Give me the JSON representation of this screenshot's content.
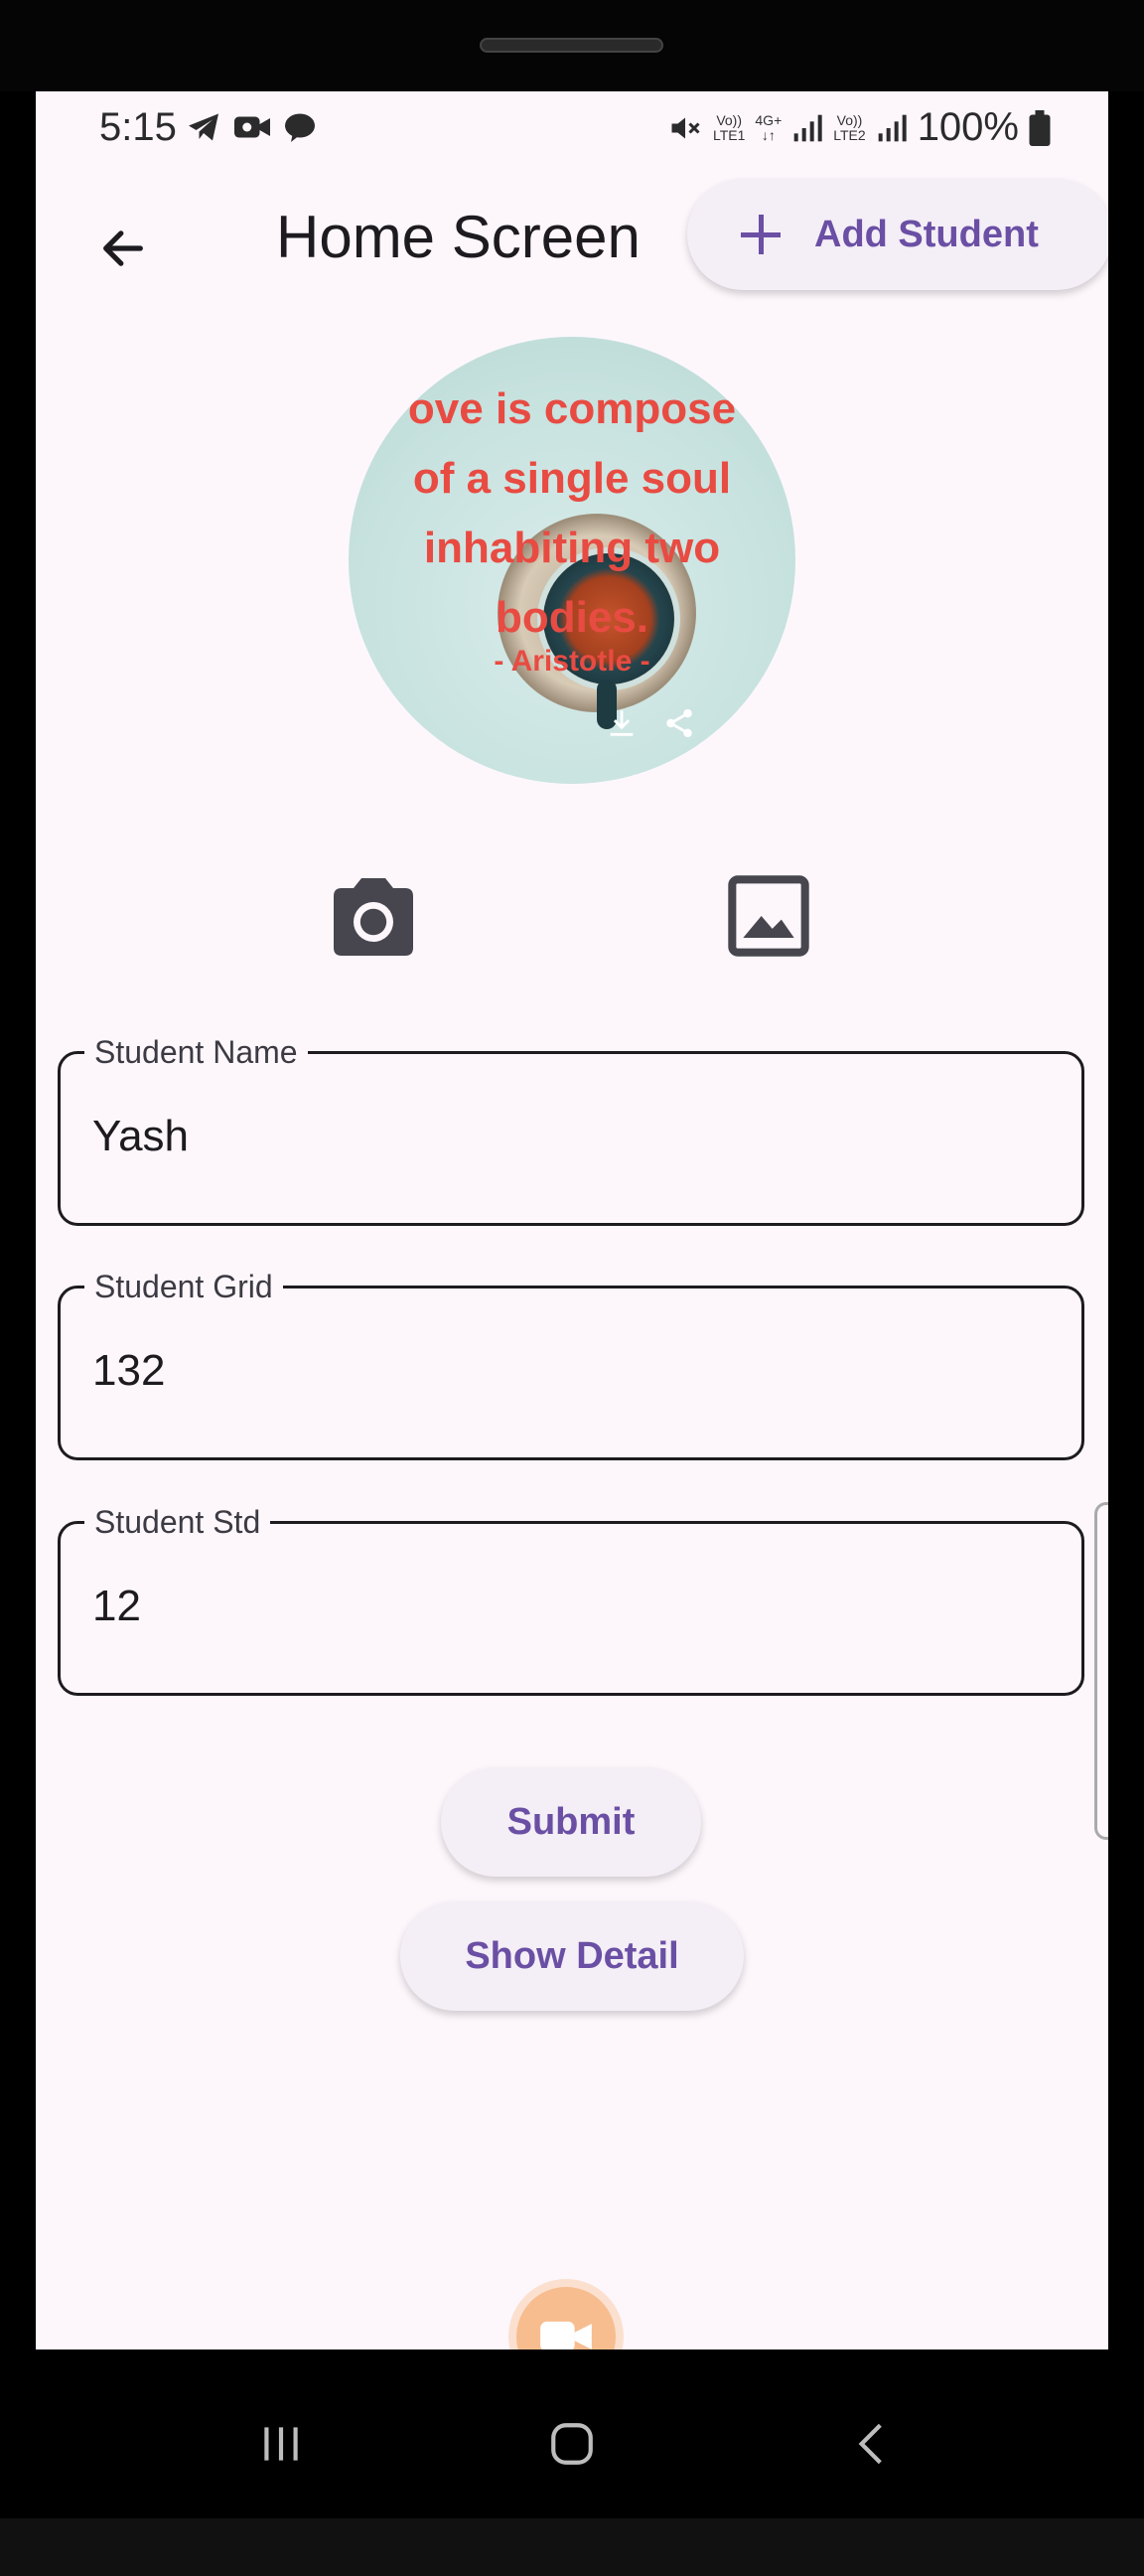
{
  "status_bar": {
    "time": "5:15",
    "left_icons": [
      "telegram-icon",
      "video-call-icon",
      "chat-bubble-icon"
    ],
    "right_icons": [
      "mute-icon",
      "volte-lte1-icon",
      "4g-plus-icon",
      "signal-icon",
      "volte-lte2-icon",
      "signal-icon",
      "battery-icon"
    ],
    "volte1_top": "Vo))",
    "volte1_bottom": "LTE1",
    "net_top": "4G+",
    "net_bottom": "↓↑",
    "volte2_top": "Vo))",
    "volte2_bottom": "LTE2",
    "battery": "100%"
  },
  "app_bar": {
    "title": "Home Screen",
    "add_label": "Add Student"
  },
  "profile_image": {
    "quote_line1": "ove is compose",
    "quote_line2": "of a single soul",
    "quote_line3": "inhabiting two",
    "quote_line4": "bodies.",
    "author": "- Aristotle -"
  },
  "form": {
    "name_label": "Student Name",
    "name_value": "Yash",
    "grid_label": "Student Grid",
    "grid_value": "132",
    "std_label": "Student Std",
    "std_value": "12"
  },
  "buttons": {
    "submit": "Submit",
    "show_detail": "Show Detail"
  },
  "colors": {
    "accent": "#6a4fa4",
    "background": "#fdf7fc",
    "button_bg": "#f4eef6",
    "quote_text": "#e84b42"
  }
}
